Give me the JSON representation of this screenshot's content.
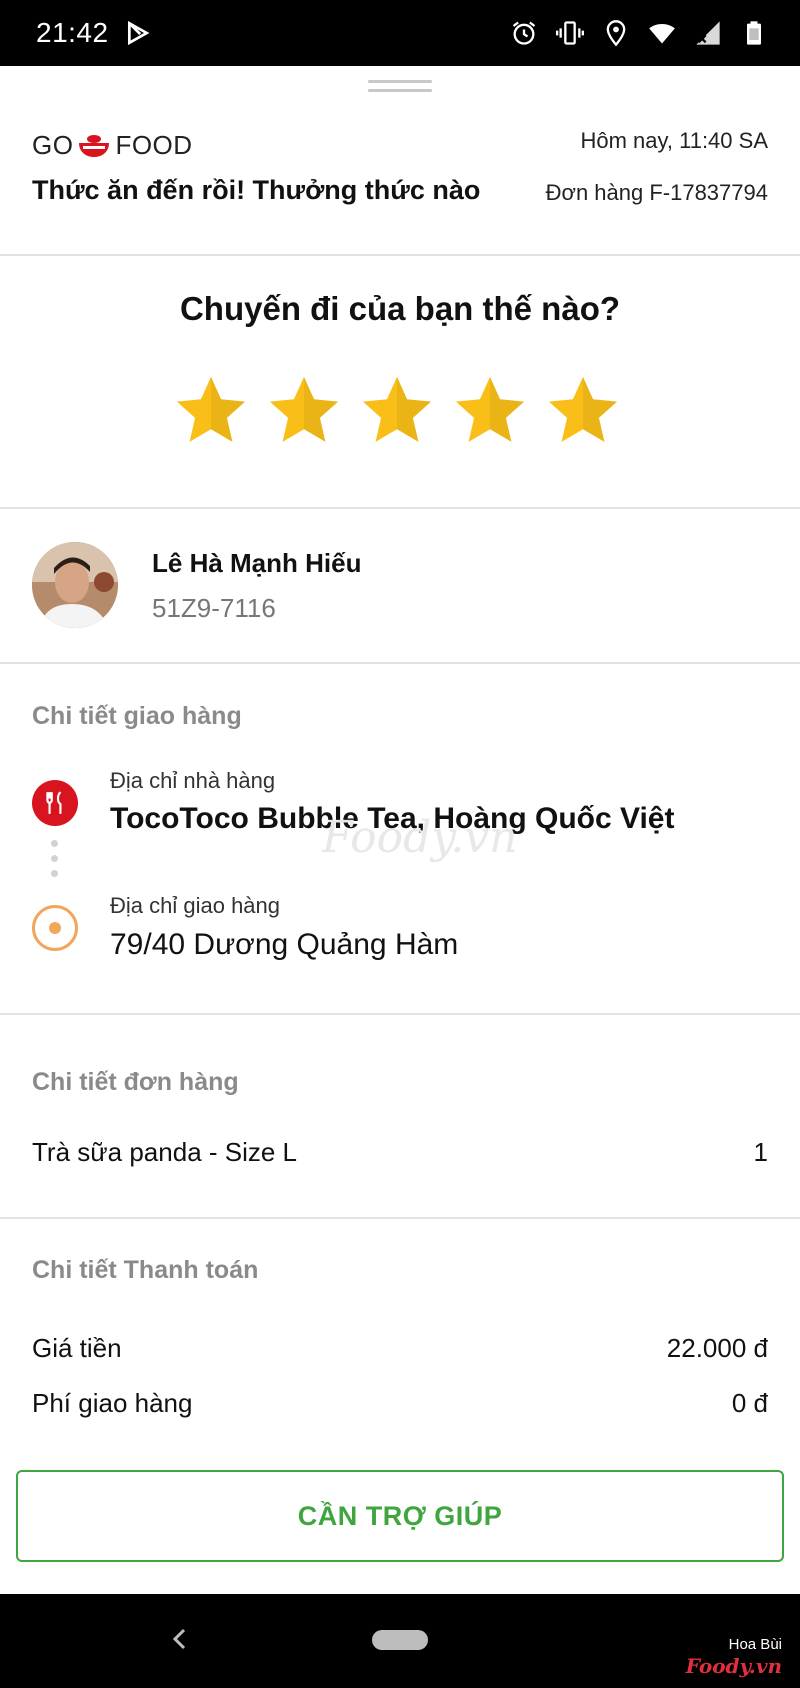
{
  "status_bar": {
    "time": "21:42",
    "icons": [
      "play-store-icon",
      "alarm-icon",
      "vibrate-icon",
      "location-icon",
      "wifi-icon",
      "no-signal-icon",
      "battery-icon"
    ]
  },
  "header": {
    "logo_left": "GO",
    "logo_right": "FOOD",
    "date": "Hôm nay, 11:40 SA",
    "title": "Thức ăn đến rồi! Thưởng thức nào",
    "order": "Đơn hàng F-17837794"
  },
  "rating": {
    "question": "Chuyến đi của bạn thế nào?",
    "stars_total": 5,
    "stars_filled": 5,
    "star_color": "#f9bf18"
  },
  "driver": {
    "name": "Lê Hà Mạnh Hiếu",
    "plate": "51Z9-7116"
  },
  "delivery": {
    "section_title": "Chi tiết giao hàng",
    "restaurant_label": "Địa chỉ nhà hàng",
    "restaurant_value": "TocoToco Bubble Tea, Hoàng Quốc Việt",
    "destination_label": "Địa chỉ giao hàng",
    "destination_value": "79/40 Dương Quảng Hàm",
    "restaurant_icon_color": "#d7141f",
    "destination_icon_color": "#f2a65a"
  },
  "watermark": "Foody.vn",
  "order_details": {
    "section_title": "Chi tiết đơn hàng",
    "items": [
      {
        "name": "Trà sữa panda - Size L",
        "qty": "1"
      }
    ]
  },
  "payment": {
    "section_title": "Chi tiết Thanh toán",
    "price_label": "Giá tiền",
    "price_value": "22.000 đ",
    "fee_label": "Phí giao hàng",
    "fee_value": "0 đ"
  },
  "help_button": {
    "label": "CẦN TRỢ GIÚP",
    "color": "#3fa53f"
  },
  "credit": {
    "name": "Hoa Bùi",
    "site": "Foody.vn"
  }
}
